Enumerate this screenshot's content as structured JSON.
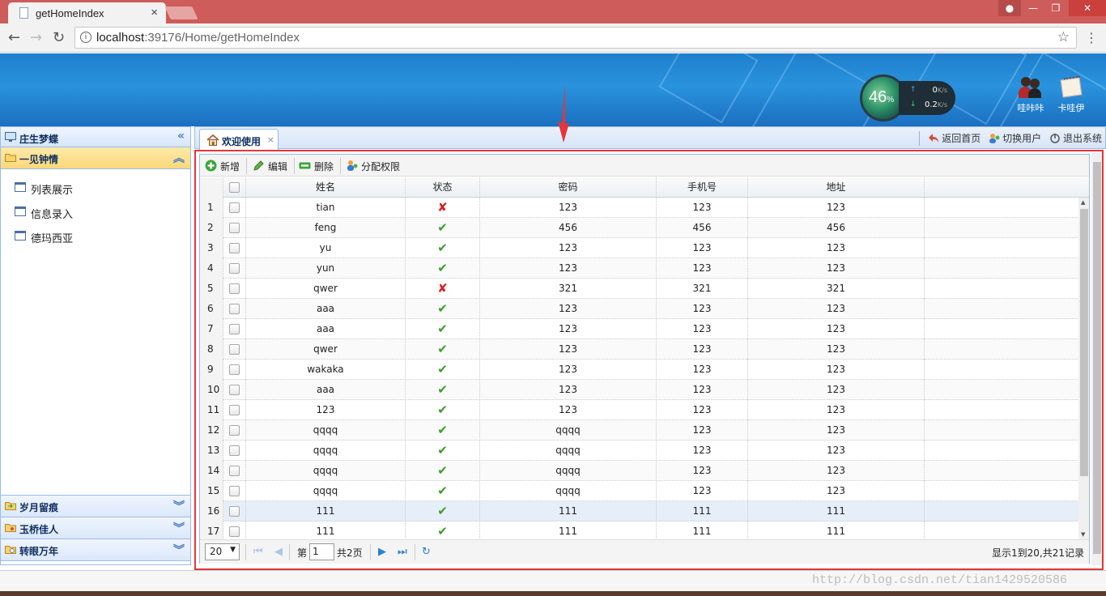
{
  "browser": {
    "tab_title": "getHomeIndex",
    "tab_close": "×",
    "url_host": "localhost",
    "url_path": ":39176/Home/getHomeIndex"
  },
  "header": {
    "gauge_value": "46",
    "gauge_unit": "%",
    "upload_speed": "0",
    "download_speed": "0.2",
    "speed_unit": "K/s",
    "user_label": "哇咔咔",
    "notes_label": "卡哇伊"
  },
  "sidebar": {
    "title": "庄生梦蝶",
    "collapse_glyph": "«",
    "active_group": "一见钟情",
    "items": [
      {
        "label": "列表展示"
      },
      {
        "label": "信息录入"
      },
      {
        "label": "德玛西亚"
      }
    ],
    "groups": [
      {
        "label": "岁月留痕"
      },
      {
        "label": "玉桥佳人"
      },
      {
        "label": "转眼万年"
      }
    ]
  },
  "tabs": {
    "welcome": "欢迎使用",
    "close": "×"
  },
  "top_actions": {
    "home": "返回首页",
    "switch_user": "切换用户",
    "logout": "退出系统"
  },
  "toolbar": {
    "add": "新增",
    "edit": "编辑",
    "delete": "删除",
    "assign": "分配权限"
  },
  "grid": {
    "columns": [
      "姓名",
      "状态",
      "密码",
      "手机号",
      "地址"
    ],
    "rows": [
      {
        "no": "1",
        "name": "tian",
        "status": false,
        "password": "123",
        "phone": "123",
        "address": "123"
      },
      {
        "no": "2",
        "name": "feng",
        "status": true,
        "password": "456",
        "phone": "456",
        "address": "456"
      },
      {
        "no": "3",
        "name": "yu",
        "status": true,
        "password": "123",
        "phone": "123",
        "address": "123"
      },
      {
        "no": "4",
        "name": "yun",
        "status": true,
        "password": "123",
        "phone": "123",
        "address": "123"
      },
      {
        "no": "5",
        "name": "qwer",
        "status": false,
        "password": "321",
        "phone": "321",
        "address": "321"
      },
      {
        "no": "6",
        "name": "aaa",
        "status": true,
        "password": "123",
        "phone": "123",
        "address": "123"
      },
      {
        "no": "7",
        "name": "aaa",
        "status": true,
        "password": "123",
        "phone": "123",
        "address": "123"
      },
      {
        "no": "8",
        "name": "qwer",
        "status": true,
        "password": "123",
        "phone": "123",
        "address": "123"
      },
      {
        "no": "9",
        "name": "wakaka",
        "status": true,
        "password": "123",
        "phone": "123",
        "address": "123"
      },
      {
        "no": "10",
        "name": "aaa",
        "status": true,
        "password": "123",
        "phone": "123",
        "address": "123"
      },
      {
        "no": "11",
        "name": "123",
        "status": true,
        "password": "123",
        "phone": "123",
        "address": "123"
      },
      {
        "no": "12",
        "name": "qqqq",
        "status": true,
        "password": "qqqq",
        "phone": "123",
        "address": "123"
      },
      {
        "no": "13",
        "name": "qqqq",
        "status": true,
        "password": "qqqq",
        "phone": "123",
        "address": "123"
      },
      {
        "no": "14",
        "name": "qqqq",
        "status": true,
        "password": "qqqq",
        "phone": "123",
        "address": "123"
      },
      {
        "no": "15",
        "name": "qqqq",
        "status": true,
        "password": "qqqq",
        "phone": "123",
        "address": "123"
      },
      {
        "no": "16",
        "name": "111",
        "status": true,
        "password": "111",
        "phone": "111",
        "address": "111"
      },
      {
        "no": "17",
        "name": "111",
        "status": true,
        "password": "111",
        "phone": "111",
        "address": "111"
      }
    ],
    "ok_glyph": "✔",
    "bad_glyph": "✘"
  },
  "pager": {
    "page_size": "20",
    "page_prefix": "第",
    "page_value": "1",
    "page_total": "共2页",
    "info": "显示1到20,共21记录"
  },
  "watermark": "http://blog.csdn.net/tian1429520586",
  "colors": {
    "frame_highlight": "#e5363a",
    "panel_border": "#99bbe8",
    "ok": "#3a9d2a",
    "bad": "#d81e1e"
  }
}
